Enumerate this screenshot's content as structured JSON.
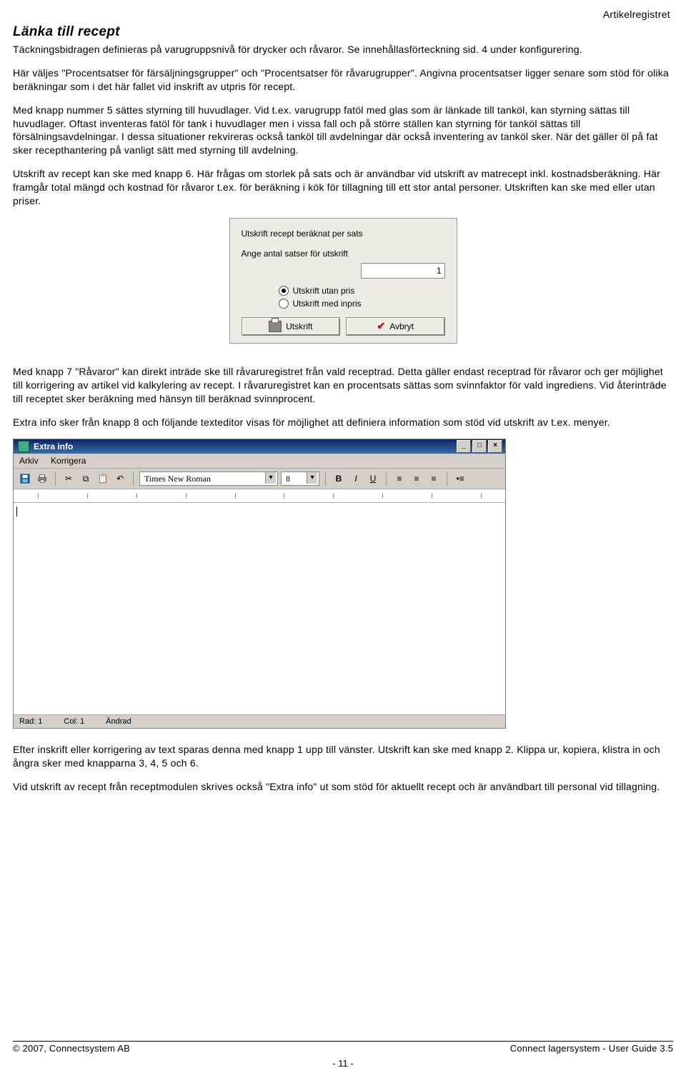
{
  "header_right": "Artikelregistret",
  "title": "Länka till recept",
  "p1": "Täckningsbidragen definieras på varugruppsnivå för drycker och råvaror. Se innehållasförteckning sid. 4 under konfigurering.",
  "p2": "Här väljes \"Procentsatser för färsäljningsgrupper\" och \"Procentsatser för råvarugrupper\". Angivna procentsatser ligger senare som stöd för olika beräkningar som i det här fallet vid inskrift av utpris för recept.",
  "p3": "Med knapp nummer 5 sättes styrning till huvudlager. Vid t.ex. varugrupp fatöl med glas som är länkade till tanköl, kan styrning sättas till huvudlager. Oftast inventeras fatöl för tank i huvudlager men i vissa fall och på större ställen kan styrning för tanköl sättas till försälningsavdelningar. I dessa situationer rekvireras också tanköl till avdelningar där också inventering av tanköl sker. När det gäller öl på fat sker recepthantering på vanligt sätt med styrning till avdelning.",
  "p4": "Utskrift av recept kan ske med knapp 6. Här frågas om storlek på sats och är användbar vid utskrift av matrecept inkl. kostnadsberäkning. Här framgår total mängd och kostnad för råvaror t.ex. för beräkning i kök för tillagning till ett stor antal personer. Utskriften kan ske med eller utan priser.",
  "dialog1": {
    "title": "Utskrift recept beräknat per sats",
    "prompt": "Ange antal satser för utskrift",
    "value": "1",
    "radio1": "Utskrift utan pris",
    "radio2": "Utskrift med inpris",
    "btn_print": "Utskrift",
    "btn_cancel": "Avbryt"
  },
  "p5": "Med knapp 7 \"Råvaror\" kan direkt inträde ske till råvaruregistret från vald receptrad. Detta gäller endast receptrad för råvaror och ger möjlighet till korrigering av artikel vid kalkylering av recept. I råvaruregistret kan en procentsats sättas som svinnfaktor för vald ingrediens. Vid återinträde till receptet sker beräkning med hänsyn till beräknad svinnprocent.",
  "p6": "Extra info sker från knapp 8 och följande texteditor visas för möjlighet att definiera information som stöd vid utskrift av t.ex. menyer.",
  "editor": {
    "title": "Extra info",
    "menu_file": "Arkiv",
    "menu_edit": "Korrigera",
    "font": "Times New Roman",
    "size": "8",
    "status_row": "Rad:  1",
    "status_col": "Col:  1",
    "status_mod": "Ändrad"
  },
  "p7": "Efter inskrift eller korrigering av text sparas denna med knapp 1 upp till vänster. Utskrift kan ske med knapp 2. Klippa ur, kopiera, klistra in och ångra sker med knapparna 3, 4, 5 och 6.",
  "p8": "Vid utskrift av recept från receptmodulen skrives också \"Extra info\" ut som stöd för aktuellt recept och är användbart till personal vid tillagning.",
  "footer_left": "© 2007, Connectsystem AB",
  "footer_right": "Connect lagersystem - User Guide 3.5",
  "footer_page": "- 11 -"
}
